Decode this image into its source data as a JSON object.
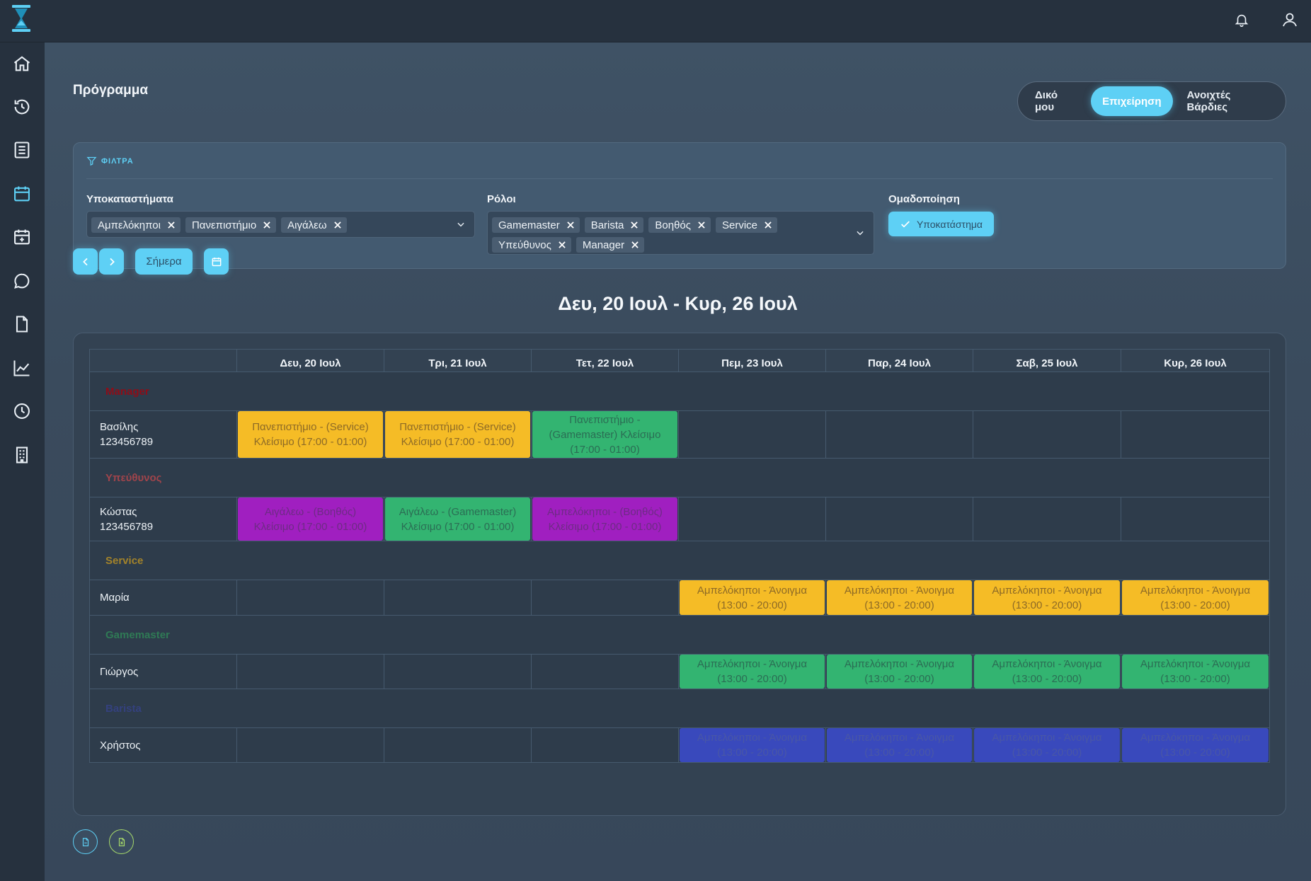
{
  "page": {
    "title": "Πρόγραμμα"
  },
  "view_toggle": {
    "options": [
      "Δικό μου",
      "Επιχείρηση",
      "Ανοιχτές Βάρδιες"
    ],
    "active": "Επιχείρηση"
  },
  "filters": {
    "header": "ΦΙΛΤΡΑ",
    "branches": {
      "label": "Υποκαταστήματα",
      "selected": [
        "Αμπελόκηποι",
        "Πανεπιστήμιο",
        "Αιγάλεω"
      ]
    },
    "roles": {
      "label": "Ρόλοι",
      "selected": [
        "Gamemaster",
        "Barista",
        "Βοηθός",
        "Service",
        "Υπεύθυνος",
        "Manager"
      ]
    },
    "grouping": {
      "label": "Ομαδοποίηση",
      "button": "Υποκατάστημα"
    }
  },
  "nav": {
    "today": "Σήμερα",
    "week_title": "Δευ, 20 Ιουλ - Κυρ, 26 Ιουλ"
  },
  "calendar": {
    "days": [
      "Δευ, 20 Ιουλ",
      "Τρι, 21 Ιουλ",
      "Τετ, 22 Ιουλ",
      "Πεμ, 23 Ιουλ",
      "Παρ, 24 Ιουλ",
      "Σαβ, 25 Ιουλ",
      "Κυρ, 26 Ιουλ"
    ],
    "groups": [
      {
        "name": "Manager",
        "color": "#8e0d18",
        "people": [
          {
            "name": "Βασίλης",
            "phone": "123456789",
            "shifts": [
              {
                "day": 0,
                "text": "Πανεπιστήμιο - (Service) Κλείσιμο (17:00 - 01:00)",
                "color": "yellow"
              },
              {
                "day": 1,
                "text": "Πανεπιστήμιο - (Service) Κλείσιμο (17:00 - 01:00)",
                "color": "yellow"
              },
              {
                "day": 2,
                "text": "Πανεπιστήμιο - (Gamemaster) Κλείσιμο (17:00 - 01:00)",
                "color": "green"
              }
            ]
          }
        ]
      },
      {
        "name": "Υπεύθυνος",
        "color": "#a0444b",
        "people": [
          {
            "name": "Κώστας",
            "phone": "123456789",
            "shifts": [
              {
                "day": 0,
                "text": "Αιγάλεω - (Βοηθός) Κλείσιμο (17:00 - 01:00)",
                "color": "purple"
              },
              {
                "day": 1,
                "text": "Αιγάλεω - (Gamemaster) Κλείσιμο (17:00 - 01:00)",
                "color": "green"
              },
              {
                "day": 2,
                "text": "Αμπελόκηποι - (Βοηθός) Κλείσιμο (17:00 - 01:00)",
                "color": "purple"
              }
            ]
          }
        ]
      },
      {
        "name": "Service",
        "color": "#a3832a",
        "people": [
          {
            "name": "Μαρία",
            "phone": "",
            "shifts": [
              {
                "day": 3,
                "text": "Αμπελόκηποι - Άνοιγμα (13:00 - 20:00)",
                "color": "yellow"
              },
              {
                "day": 4,
                "text": "Αμπελόκηποι - Άνοιγμα (13:00 - 20:00)",
                "color": "yellow"
              },
              {
                "day": 5,
                "text": "Αμπελόκηποι - Άνοιγμα (13:00 - 20:00)",
                "color": "yellow"
              },
              {
                "day": 6,
                "text": "Αμπελόκηποι - Άνοιγμα (13:00 - 20:00)",
                "color": "yellow"
              }
            ]
          }
        ]
      },
      {
        "name": "Gamemaster",
        "color": "#2f7a55",
        "people": [
          {
            "name": "Γιώργος",
            "phone": "",
            "shifts": [
              {
                "day": 3,
                "text": "Αμπελόκηποι - Άνοιγμα (13:00 - 20:00)",
                "color": "green"
              },
              {
                "day": 4,
                "text": "Αμπελόκηποι - Άνοιγμα (13:00 - 20:00)",
                "color": "green"
              },
              {
                "day": 5,
                "text": "Αμπελόκηποι - Άνοιγμα (13:00 - 20:00)",
                "color": "green"
              },
              {
                "day": 6,
                "text": "Αμπελόκηποι - Άνοιγμα (13:00 - 20:00)",
                "color": "green"
              }
            ]
          }
        ]
      },
      {
        "name": "Barista",
        "color": "#34417e",
        "people": [
          {
            "name": "Χρήστος",
            "phone": "",
            "shifts": [
              {
                "day": 3,
                "text": "Αμπελόκηποι - Άνοιγμα (13:00 - 20:00)",
                "color": "blue"
              },
              {
                "day": 4,
                "text": "Αμπελόκηποι - Άνοιγμα (13:00 - 20:00)",
                "color": "blue"
              },
              {
                "day": 5,
                "text": "Αμπελόκηποι - Άνοιγμα (13:00 - 20:00)",
                "color": "blue"
              },
              {
                "day": 6,
                "text": "Αμπελόκηποι - Άνοιγμα (13:00 - 20:00)",
                "color": "blue"
              }
            ]
          }
        ]
      }
    ]
  },
  "icons": {
    "sidebar": [
      "home-icon",
      "history-icon",
      "list-icon",
      "calendar-icon",
      "calendar-plus-icon",
      "chat-icon",
      "file-icon",
      "chart-icon",
      "clock-icon",
      "building-icon"
    ],
    "topbar": [
      "bell-icon",
      "user-icon"
    ]
  },
  "colors": {
    "accent": "#5ed0f5",
    "yellow": "#f5bc26",
    "green": "#33b471",
    "purple": "#a01fc0",
    "blue": "#3949bc"
  }
}
